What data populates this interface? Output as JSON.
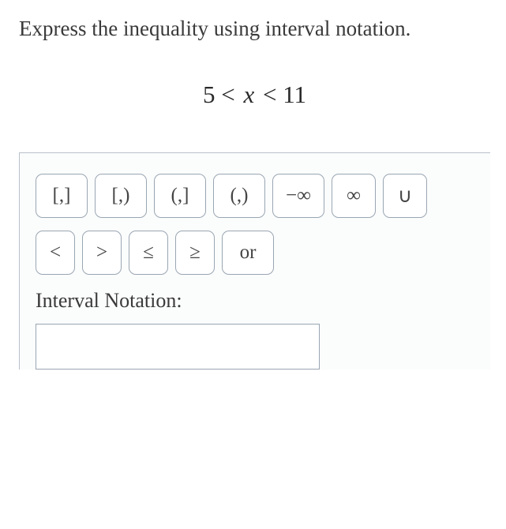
{
  "prompt": "Express the inequality using interval notation.",
  "expression": {
    "left": "5",
    "op1": "<",
    "var": "x",
    "op2": "<",
    "right": "11"
  },
  "buttons_row1": [
    {
      "name": "closed-closed-button",
      "label": "[,]"
    },
    {
      "name": "closed-open-button",
      "label": "[,)"
    },
    {
      "name": "open-closed-button",
      "label": "(,]"
    },
    {
      "name": "open-open-button",
      "label": "(,)"
    },
    {
      "name": "neg-infinity-button",
      "label": "−∞"
    },
    {
      "name": "infinity-button",
      "label": "∞"
    },
    {
      "name": "union-button",
      "label": "∪"
    }
  ],
  "buttons_row2": [
    {
      "name": "less-than-button",
      "label": "<"
    },
    {
      "name": "greater-than-button",
      "label": ">"
    },
    {
      "name": "leq-button",
      "label": "≤"
    },
    {
      "name": "geq-button",
      "label": "≥"
    },
    {
      "name": "or-button",
      "label": "or"
    }
  ],
  "answer_label": "Interval Notation:",
  "answer_value": ""
}
